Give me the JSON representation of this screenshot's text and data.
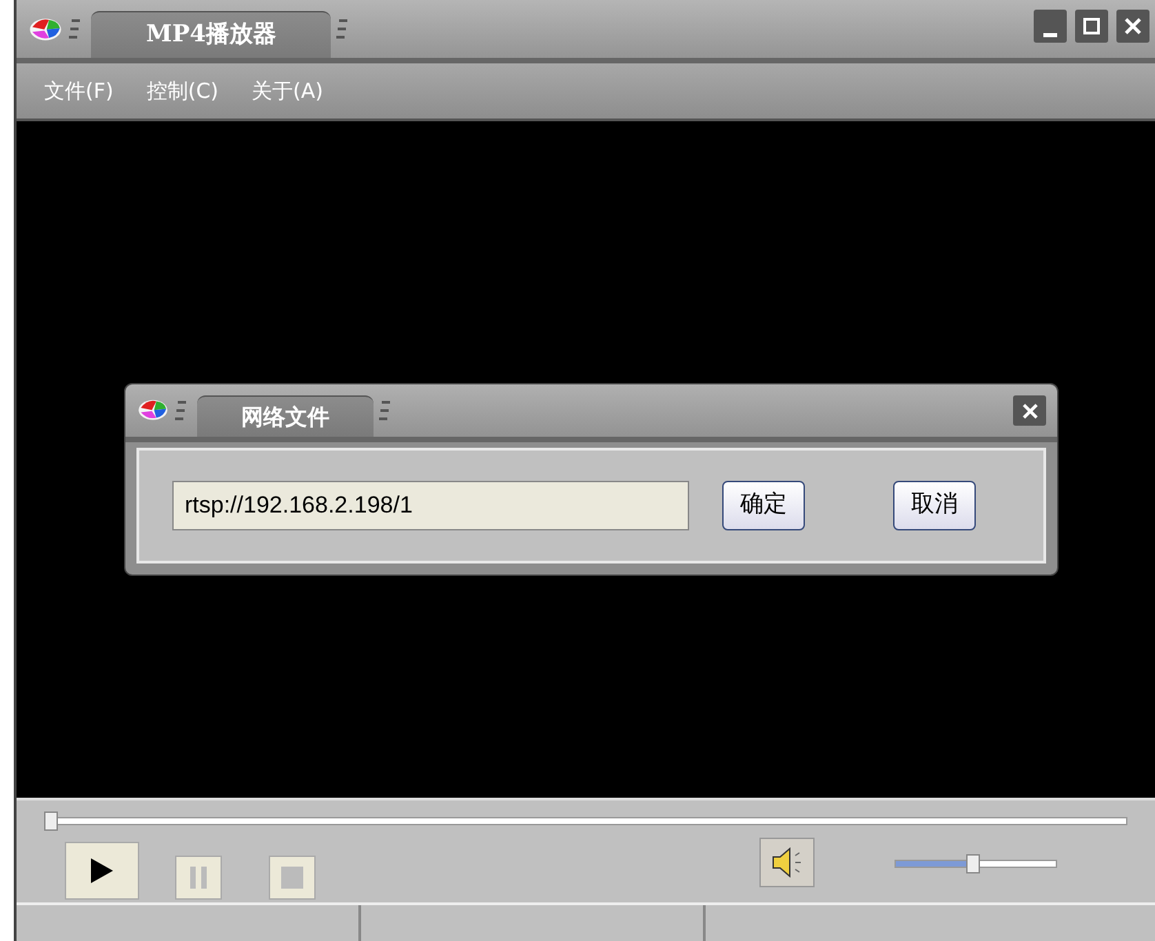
{
  "window": {
    "title": "MP4播放器"
  },
  "menu": [
    "文件(F)",
    "控制(C)",
    "关于(A)"
  ],
  "dialog": {
    "title": "网络文件",
    "url_field": {
      "value": "rtsp://192.168.2.198/1"
    },
    "buttons": [
      "确定",
      "取消"
    ]
  },
  "progress": {
    "level": 0
  },
  "volume": {
    "level": 0.48
  }
}
